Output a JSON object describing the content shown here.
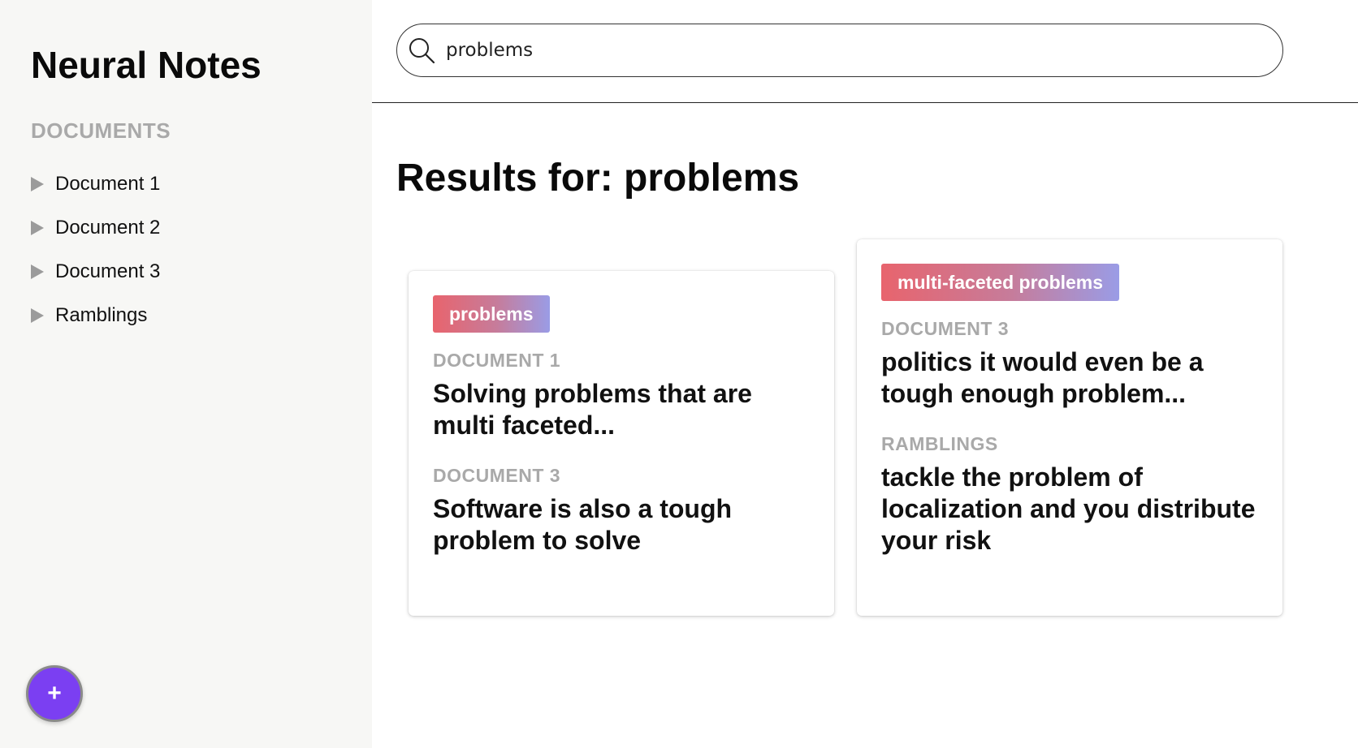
{
  "sidebar": {
    "app_title": "Neural Notes",
    "section_label": "DOCUMENTS",
    "documents": [
      {
        "label": "Document 1"
      },
      {
        "label": "Document 2"
      },
      {
        "label": "Document 3"
      },
      {
        "label": "Ramblings"
      }
    ],
    "add_button_label": "+"
  },
  "search": {
    "value": "problems",
    "icon": "search-icon"
  },
  "results": {
    "title": "Results for: problems",
    "cards": [
      {
        "tag": "problems",
        "snippets": [
          {
            "document": "DOCUMENT 1",
            "text": "Solving problems that are multi faceted..."
          },
          {
            "document": "DOCUMENT 3",
            "text": "Software is also a tough problem to solve"
          }
        ]
      },
      {
        "tag": "multi-faceted problems",
        "snippets": [
          {
            "document": "DOCUMENT 3",
            "text": "politics it would even be a tough enough problem..."
          },
          {
            "document": "RAMBLINGS",
            "text": "tackle the problem of localization and you distribute your risk"
          }
        ]
      }
    ]
  },
  "colors": {
    "sidebar_bg": "#f7f7f5",
    "fab": "#7b3ff2",
    "tag_gradient_start": "#e8646d",
    "tag_gradient_end": "#9a9ce6",
    "muted_label": "#a9a9a9"
  }
}
